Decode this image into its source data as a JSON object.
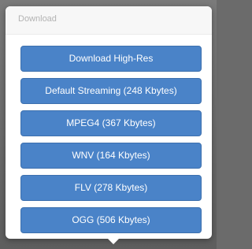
{
  "popover": {
    "title": "Download",
    "buttons": [
      {
        "label": "Download High-Res"
      },
      {
        "label": "Default Streaming (248 Kbytes)"
      },
      {
        "label": "MPEG4 (367 Kbytes)"
      },
      {
        "label": "WNV (164 Kbytes)"
      },
      {
        "label": "FLV (278 Kbytes)"
      },
      {
        "label": "OGG (506 Kbytes)"
      }
    ]
  },
  "colors": {
    "button_background": "#4a83c8",
    "button_text": "#ffffff",
    "header_text": "#b3b3b3"
  }
}
